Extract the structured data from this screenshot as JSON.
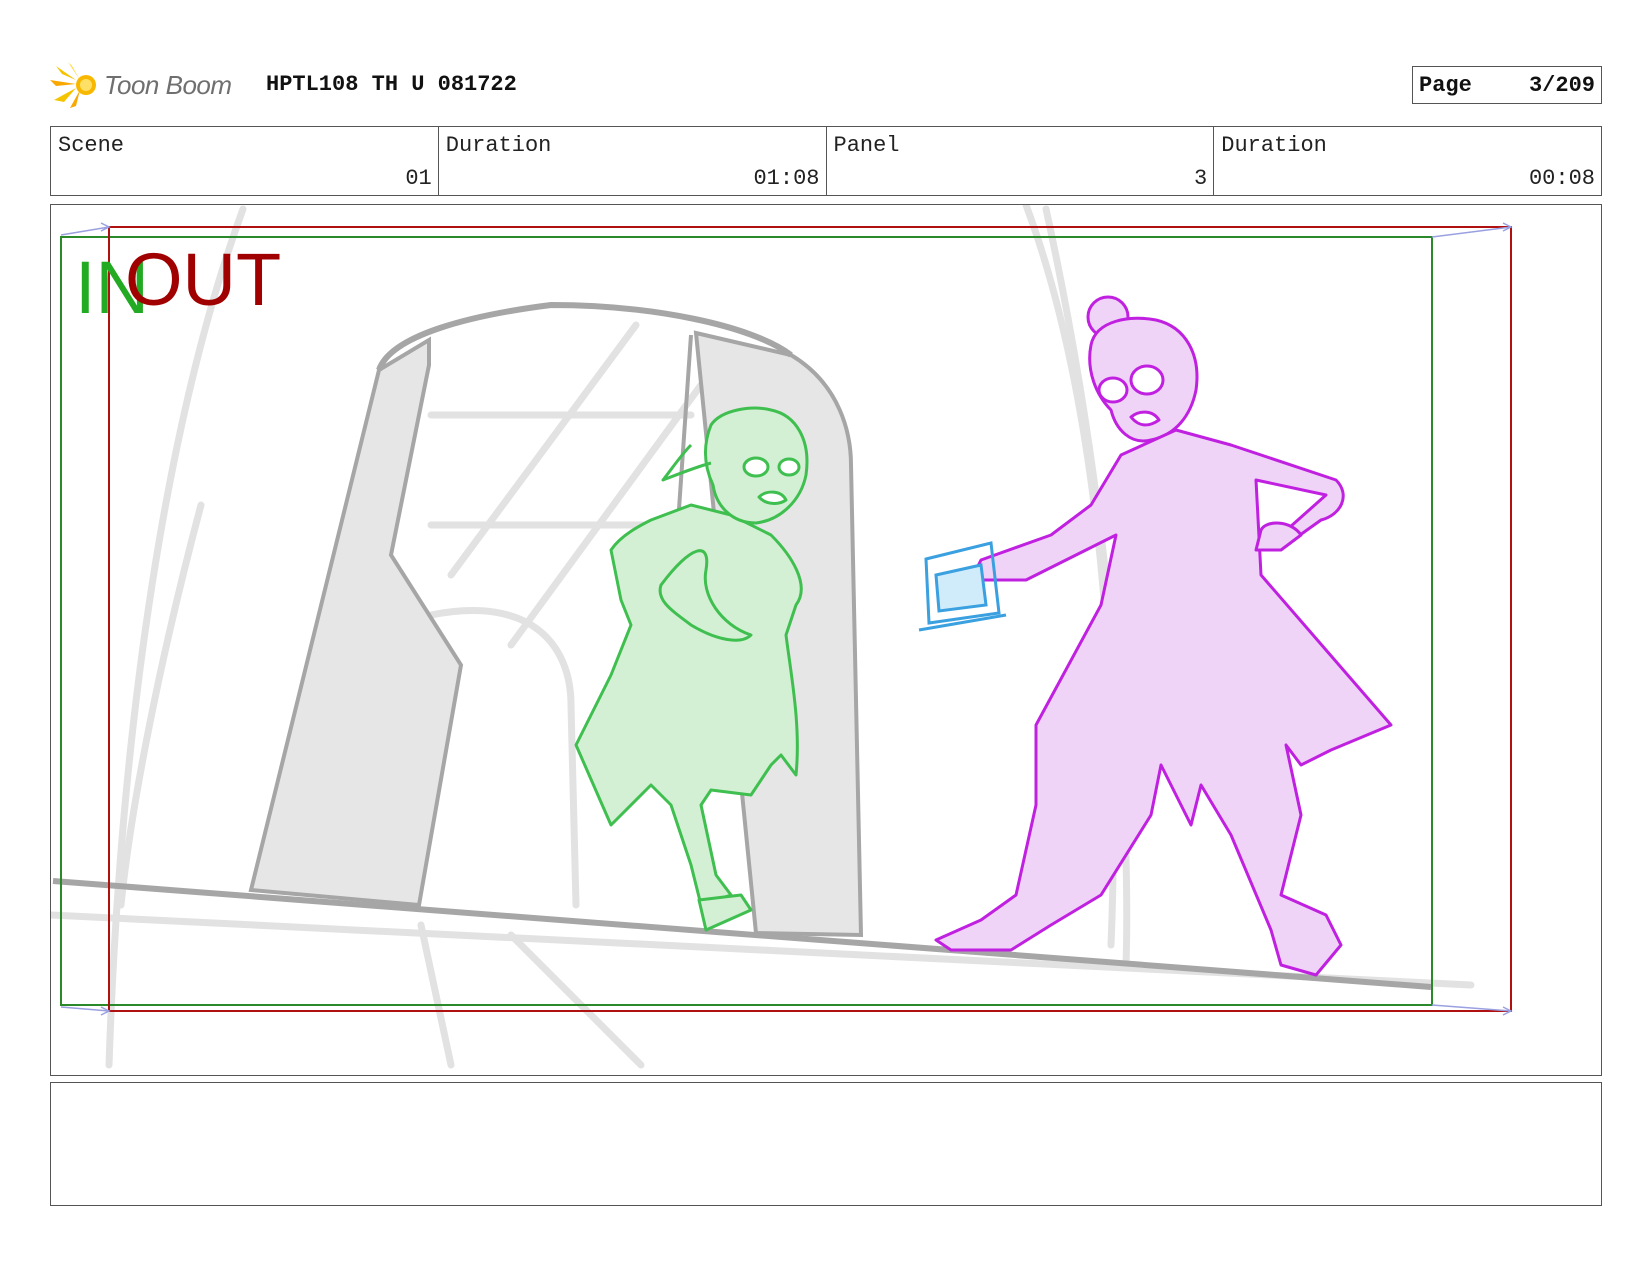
{
  "header": {
    "logo_text": "Toon Boom",
    "title": "HPTL108 TH U 081722",
    "page_label": "Page",
    "page_value": "3/209"
  },
  "info": {
    "scene_label": "Scene",
    "scene_value": "01",
    "duration_label": "Duration",
    "duration_value": "01:08",
    "panel_label": "Panel",
    "panel_value": "3",
    "panel_duration_label": "Duration",
    "panel_duration_value": "00:08"
  },
  "frame": {
    "in_label": "IN",
    "out_label": "OUT"
  },
  "notes": {
    "text": ""
  },
  "colors": {
    "in_frame": "#2a8a2a",
    "out_frame": "#b01010",
    "character_left": "#3fbf4f",
    "character_right": "#c020e0",
    "prop": "#3aa0e0",
    "background_sketch": "#9a9a9a"
  }
}
